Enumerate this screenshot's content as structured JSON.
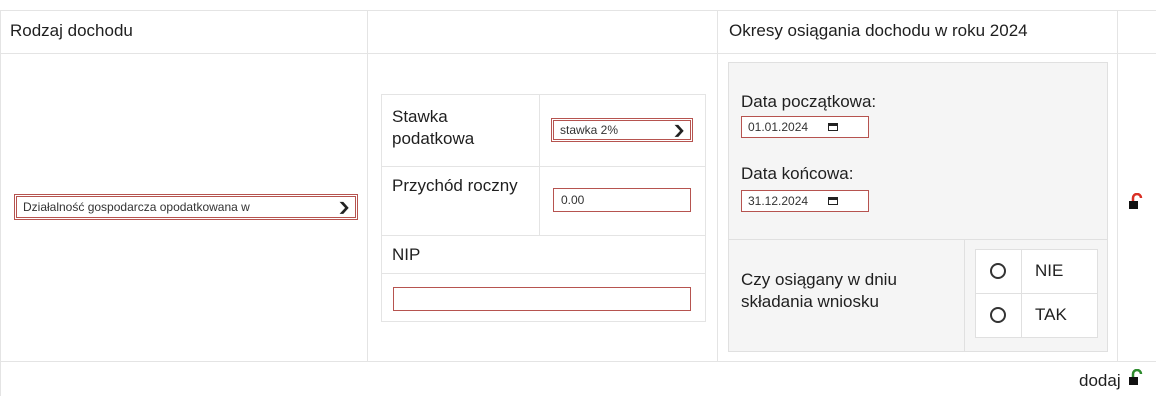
{
  "headers": {
    "income_type": "Rodzaj dochodu",
    "middle": "",
    "periods": "Okresy osiągania dochodu w roku 2024"
  },
  "income_type_select": {
    "selected": "Działalność gospodarcza opodatkowana w"
  },
  "details": {
    "tax_rate_label": "Stawka podatkowa",
    "tax_rate_selected": "stawka 2%",
    "revenue_label": "Przychód roczny",
    "revenue_value": "0.00",
    "nip_label": "NIP",
    "nip_value": ""
  },
  "period": {
    "start_label": "Data początkowa:",
    "start_value": "01.01.2024",
    "end_label": "Data końcowa:",
    "end_value": "31.12.2024",
    "achieved_question": "Czy osiągany w dniu składania wniosku",
    "options": [
      "NIE",
      "TAK"
    ]
  },
  "footer": {
    "add_label": "dodaj"
  },
  "colors": {
    "field_border": "#b6534f",
    "grid_line": "#e4e4e4",
    "panel_bg": "#f5f5f5",
    "remove_icon": "#d93025",
    "add_icon": "#2e8b2e"
  },
  "icons": {
    "remove": "unlock-remove-icon",
    "add": "unlock-add-icon",
    "select_arrow": "chevron-down-icon",
    "calendar": "calendar-icon"
  }
}
